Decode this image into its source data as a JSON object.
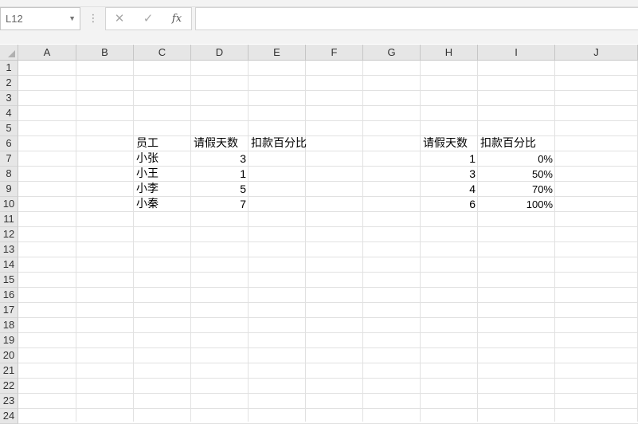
{
  "formula_bar": {
    "name_box": "L12",
    "cancel_icon": "close-icon",
    "enter_icon": "check-icon",
    "function_label": "fx",
    "formula": ""
  },
  "columns": [
    "A",
    "B",
    "C",
    "D",
    "E",
    "F",
    "G",
    "H",
    "I",
    "J"
  ],
  "rows": [
    "1",
    "2",
    "3",
    "4",
    "5",
    "6",
    "7",
    "8",
    "9",
    "10",
    "11",
    "12",
    "13",
    "14",
    "15",
    "16",
    "17",
    "18",
    "19",
    "20",
    "21",
    "22",
    "23",
    "24"
  ],
  "cells": {
    "C6": "员工",
    "D6": "请假天数",
    "E6": "扣款百分比",
    "C7": "小张",
    "D7": "3",
    "C8": "小王",
    "D8": "1",
    "C9": "小李",
    "D9": "5",
    "C10": "小秦",
    "D10": "7",
    "H6": "请假天数",
    "I6": "扣款百分比",
    "H7": "1",
    "I7": "0%",
    "H8": "3",
    "I8": "50%",
    "H9": "4",
    "I9": "70%",
    "H10": "6",
    "I10": "100%"
  },
  "colors": {
    "header_bg": "#e6e6e6",
    "gridline": "#e1e1e1",
    "toolbar_bg": "#f3f3f3"
  }
}
